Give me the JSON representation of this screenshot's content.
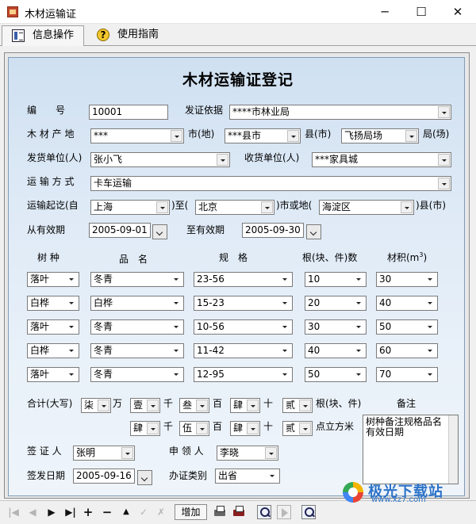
{
  "window": {
    "title": "木材运输证",
    "minimize": "─",
    "maximize": "☐",
    "close": "✕"
  },
  "tabs": [
    {
      "label": "信息操作",
      "icon": "document-icon"
    },
    {
      "label": "使用指南",
      "icon": "help-icon",
      "glyph": "?"
    }
  ],
  "form": {
    "heading": "木材运输证登记",
    "labels": {
      "number": "编　　号",
      "basis": "发证依据",
      "origin": "木 材 产 地",
      "city_suffix": "市(地)",
      "county_suffix": "县(市)",
      "bureau_suffix": "局(场)",
      "sender": "发货单位(人)",
      "receiver": "收货单位(人)",
      "transport": "运 输 方 式",
      "route": "运输起讫(自",
      "route_to": ")至(",
      "route_city": ")市或地(",
      "route_county": ")县(市)",
      "valid_from": "从有效期",
      "valid_to": "至有效期",
      "col_species": "树  种",
      "col_name": "品　名",
      "col_spec": "规　格",
      "col_count": "根(块、件)数",
      "col_volume": "材积(m",
      "col_volume_sup": "3",
      "col_volume_close": ")",
      "total": "合计(大写)",
      "wan": "万",
      "qian": "千",
      "bai": "百",
      "shi": "十",
      "count_unit": "根(块、件)",
      "remark": "备注",
      "cubic": "点立方米",
      "certifier": "签 证 人",
      "applicant": "申 领 人",
      "issue_date": "签发日期",
      "issue_type": "办证类别"
    },
    "values": {
      "number": "10001",
      "basis": "****市林业局",
      "origin_city": "***",
      "origin_county": "***县市",
      "origin_bureau": "飞扬局场",
      "sender": "张小飞",
      "receiver": "***家具城",
      "transport": "卡车运输",
      "route_from": "上海",
      "route_to": "北京",
      "route_county": "海淀区",
      "valid_from": "2005-09-01",
      "valid_to": "2005-09-30",
      "count_wan": "柒",
      "count_qian": "壹",
      "count_bai": "叁",
      "count_shi": "肆",
      "count_ge": "贰",
      "vol_qian": "肆",
      "vol_bai": "伍",
      "vol_shi": "肆",
      "vol_ge": "贰",
      "remark_line1": "树种备注规格品名",
      "remark_line2": "有效日期",
      "certifier": "张明",
      "applicant": "李晓",
      "issue_date": "2005-09-16",
      "issue_type": "出省"
    },
    "rows": [
      {
        "species": "落叶",
        "name": "冬青",
        "spec": "23-56",
        "count": "10",
        "volume": "30"
      },
      {
        "species": "白桦",
        "name": "白桦",
        "spec": "15-23",
        "count": "20",
        "volume": "40"
      },
      {
        "species": "落叶",
        "name": "冬青",
        "spec": "10-56",
        "count": "30",
        "volume": "50"
      },
      {
        "species": "白桦",
        "name": "冬青",
        "spec": "11-42",
        "count": "40",
        "volume": "60"
      },
      {
        "species": "落叶",
        "name": "冬青",
        "spec": "12-95",
        "count": "50",
        "volume": "70"
      }
    ]
  },
  "toolbar": {
    "first": "|◀",
    "prev": "◀",
    "next": "▶",
    "last": "▶|",
    "insert": "+",
    "delete": "−",
    "up": "▲",
    "post": "✓",
    "cancel": "✗",
    "add_label": "增加"
  },
  "watermark": {
    "brand": "极光下载站",
    "url": "www.xz7.com"
  }
}
